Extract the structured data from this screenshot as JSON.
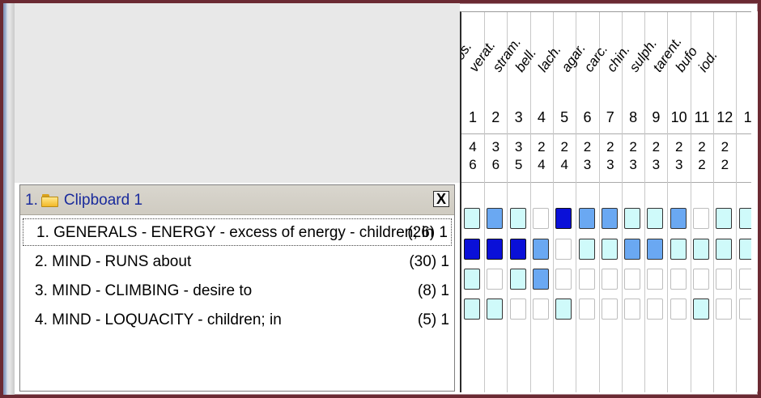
{
  "clipboard": {
    "index": "1.",
    "title": "Clipboard 1",
    "close_label": "X",
    "rubrics": [
      {
        "text": "1. GENERALS - ENERGY - excess of energy - children; in",
        "count": "(26) 1"
      },
      {
        "text": "2. MIND - RUNS about",
        "count": "(30) 1"
      },
      {
        "text": "3. MIND - CLIMBING - desire to",
        "count": "(8) 1"
      },
      {
        "text": "4. MIND - LOQUACITY - children; in",
        "count": "(5) 1"
      }
    ]
  },
  "repertorization": {
    "remedies": [
      {
        "name": "hyos.",
        "num": "1",
        "count": "4",
        "degree": "6",
        "grades": [
          1,
          3,
          1,
          1
        ]
      },
      {
        "name": "verat.",
        "num": "2",
        "count": "3",
        "degree": "6",
        "grades": [
          2,
          3,
          0,
          1
        ]
      },
      {
        "name": "stram.",
        "num": "3",
        "count": "3",
        "degree": "5",
        "grades": [
          1,
          3,
          1,
          0
        ]
      },
      {
        "name": "bell.",
        "num": "4",
        "count": "2",
        "degree": "4",
        "grades": [
          0,
          2,
          2,
          0
        ]
      },
      {
        "name": "lach.",
        "num": "5",
        "count": "2",
        "degree": "4",
        "grades": [
          3,
          0,
          0,
          1
        ]
      },
      {
        "name": "agar.",
        "num": "6",
        "count": "2",
        "degree": "3",
        "grades": [
          2,
          1,
          0,
          0
        ]
      },
      {
        "name": "carc.",
        "num": "7",
        "count": "2",
        "degree": "3",
        "grades": [
          2,
          1,
          0,
          0
        ]
      },
      {
        "name": "chin.",
        "num": "8",
        "count": "2",
        "degree": "3",
        "grades": [
          1,
          2,
          0,
          0
        ]
      },
      {
        "name": "sulph.",
        "num": "9",
        "count": "2",
        "degree": "3",
        "grades": [
          1,
          2,
          0,
          0
        ]
      },
      {
        "name": "tarent.",
        "num": "10",
        "count": "2",
        "degree": "3",
        "grades": [
          2,
          1,
          0,
          0
        ]
      },
      {
        "name": "bufo",
        "num": "11",
        "count": "2",
        "degree": "2",
        "grades": [
          0,
          1,
          0,
          1
        ]
      },
      {
        "name": "iod.",
        "num": "12",
        "count": "2",
        "degree": "2",
        "grades": [
          1,
          1,
          0,
          0
        ]
      },
      {
        "name": "",
        "num": "1",
        "count": "",
        "degree": "",
        "grades": [
          1,
          1,
          0,
          0
        ]
      }
    ],
    "grade_colors": {
      "0": "#ffffff",
      "1": "#cffafa",
      "2": "#6aa8f2",
      "3": "#0a10d8"
    }
  }
}
